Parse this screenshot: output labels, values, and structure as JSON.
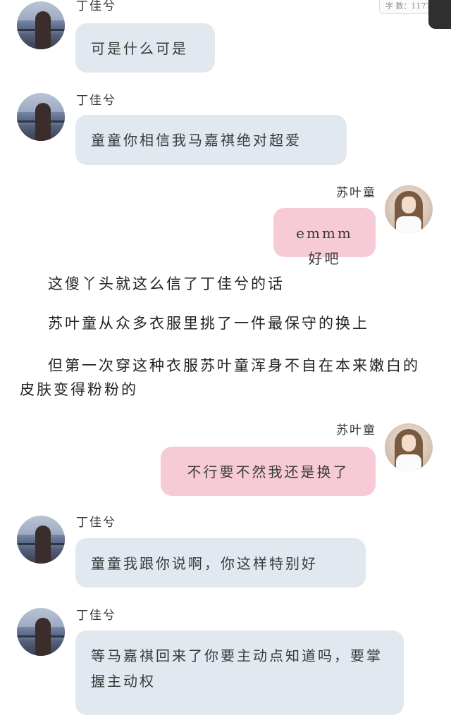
{
  "top_bar": {
    "word_count": "字 数：1177"
  },
  "messages": [
    {
      "sender": "丁佳兮",
      "text": "可是什么可是"
    },
    {
      "sender": "丁佳兮",
      "text": "童童你相信我马嘉祺绝对超爱"
    },
    {
      "sender": "苏叶童",
      "text": "emmm好吧"
    },
    {
      "sender": "苏叶童",
      "text": "不行要不然我还是换了"
    },
    {
      "sender": "丁佳兮",
      "text": "童童我跟你说啊，你这样特别好"
    },
    {
      "sender": "丁佳兮",
      "text": "等马嘉祺回来了你要主动点知道吗，要掌握主动权"
    }
  ],
  "narration": [
    "这傻丫头就这么信了丁佳兮的话",
    "苏叶童从众多衣服里挑了一件最保守的换上",
    "但第一次穿这种衣服苏叶童浑身不自在本来嫩白的皮肤变得粉粉的"
  ]
}
